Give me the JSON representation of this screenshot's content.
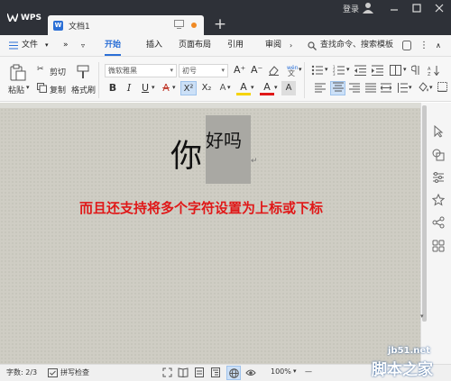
{
  "titlebar": {
    "app_name": "WPS",
    "doc_tab_title": "文档1",
    "doc_icon_letter": "W",
    "new_tab": "+",
    "login": "登录"
  },
  "menu": {
    "file": "文件",
    "more_left": "»",
    "tabs": [
      "开始",
      "插入",
      "页面布局",
      "引用",
      "审阅"
    ],
    "active_tab": "开始",
    "search_placeholder": "查找命令、搜索模板"
  },
  "ribbon": {
    "paste": "粘贴",
    "cut": "剪切",
    "copy": "复制",
    "format_painter": "格式刷",
    "font_name": "微软雅黑",
    "font_size": "初号",
    "bold": "B",
    "italic": "I",
    "underline": "U",
    "strikethrough": "A",
    "superscript": "X²",
    "subscript": "X₂",
    "text_color": "A",
    "char_shading": "A",
    "grow_font": "A⁺",
    "shrink_font": "A⁻"
  },
  "document": {
    "big_char": "你",
    "superscript_text": "好吗",
    "para_mark": "↵",
    "red_text": "而且还支持将多个字符设置为上标或下标",
    "red_color": "#e01818"
  },
  "statusbar": {
    "word_count": "字数: 2/3",
    "spell_check": "拼写检查",
    "zoom": "100%"
  },
  "watermark": {
    "domain": "jb51.net",
    "name": "脚本之家"
  },
  "colors": {
    "titlebar": "#2e3138",
    "accent": "#2b6fd6",
    "page": "#cfcdc4"
  }
}
